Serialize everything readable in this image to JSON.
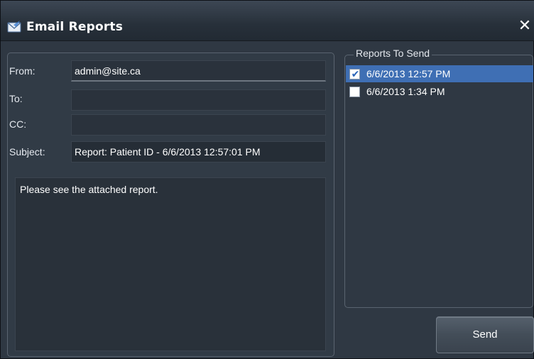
{
  "window": {
    "title": "Email Reports",
    "icon": "envelope-icon",
    "close_label": "✕"
  },
  "email": {
    "from_label": "From:",
    "from_value": "admin@site.ca",
    "to_label": "To:",
    "to_value": "",
    "cc_label": "CC:",
    "cc_value": "",
    "subject_label": "Subject:",
    "subject_value": "Report: Patient ID - 6/6/2013 12:57:01 PM",
    "body": "Please see the attached report."
  },
  "reports": {
    "group_label": "Reports To Send",
    "items": [
      {
        "label": "6/6/2013 12:57 PM",
        "checked": true,
        "selected": true
      },
      {
        "label": "6/6/2013 1:34 PM",
        "checked": false,
        "selected": false
      }
    ]
  },
  "actions": {
    "send_label": "Send"
  },
  "colors": {
    "window_bg": "#2f3843",
    "selection": "#3f6fb4",
    "field_bg": "#2a323c"
  }
}
